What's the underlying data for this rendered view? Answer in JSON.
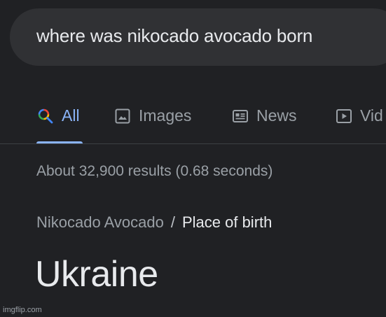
{
  "search": {
    "query": "where was nikocado avocado born"
  },
  "tabs": [
    {
      "label": "All",
      "icon": "search-icon",
      "active": true
    },
    {
      "label": "Images",
      "icon": "image-icon",
      "active": false
    },
    {
      "label": "News",
      "icon": "news-icon",
      "active": false
    },
    {
      "label": "Vid",
      "icon": "video-icon",
      "active": false
    }
  ],
  "results": {
    "stats": "About 32,900 results (0.68 seconds)"
  },
  "answer": {
    "entity": "Nikocado Avocado",
    "separator": "/",
    "attribute": "Place of birth",
    "value": "Ukraine"
  },
  "watermark": "imgflip.com",
  "colors": {
    "background": "#202124",
    "search_box": "#303134",
    "accent": "#8ab4f8",
    "muted_text": "#9aa0a6",
    "primary_text": "#e8eaed"
  }
}
